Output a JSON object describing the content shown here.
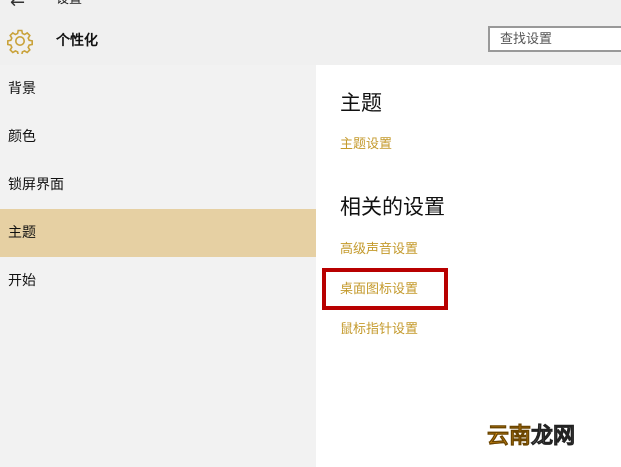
{
  "window": {
    "title": "设置"
  },
  "header": {
    "section_title": "个性化",
    "search": {
      "placeholder": "查找设置",
      "value": ""
    }
  },
  "sidebar": {
    "items": [
      {
        "label": "背景",
        "selected": false
      },
      {
        "label": "颜色",
        "selected": false
      },
      {
        "label": "锁屏界面",
        "selected": false
      },
      {
        "label": "主题",
        "selected": true
      },
      {
        "label": "开始",
        "selected": false
      }
    ]
  },
  "main": {
    "theme_heading": "主题",
    "theme_settings_link": "主题设置",
    "related_heading": "相关的设置",
    "related_links": [
      "高级声音设置",
      "桌面图标设置",
      "鼠标指针设置"
    ]
  },
  "watermark": {
    "part1": "云南",
    "part2": "龙网"
  },
  "colors": {
    "accent_link": "#c49a2c",
    "selected_nav": "#e6d0a3",
    "highlight_box": "#b80000",
    "sidebar_bg": "#f2f2f2"
  },
  "icons": {
    "back": "back-arrow-icon",
    "personalization": "gear-icon"
  }
}
